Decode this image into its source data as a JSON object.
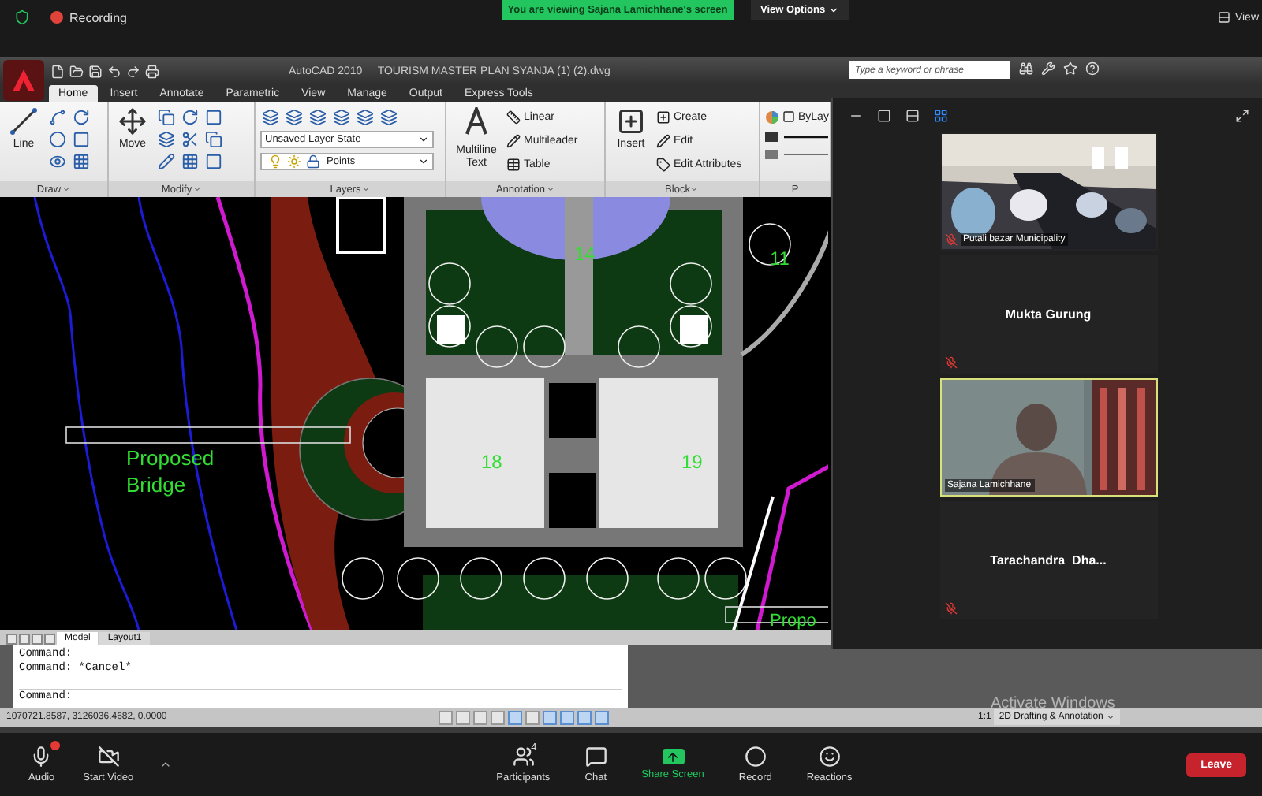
{
  "meeting_bar": {
    "recording_label": "Recording",
    "share_banner": "You are viewing Sajana Lamichhane's screen",
    "view_options": "View Options",
    "view_button": "View"
  },
  "cad": {
    "app_title": "AutoCAD 2010",
    "file_title": "TOURISM MASTER PLAN SYANJA (1) (2).dwg",
    "search": {
      "placeholder": "Type a keyword or phrase"
    },
    "ribbon_tabs": [
      {
        "label": "Home",
        "selected": true
      },
      {
        "label": "Insert",
        "selected": false
      },
      {
        "label": "Annotate",
        "selected": false
      },
      {
        "label": "Parametric",
        "selected": false
      },
      {
        "label": "View",
        "selected": false
      },
      {
        "label": "Manage",
        "selected": false
      },
      {
        "label": "Output",
        "selected": false
      },
      {
        "label": "Express Tools",
        "selected": false
      }
    ],
    "ribbon_panels": [
      {
        "kind": "draw",
        "title": "Draw",
        "big": "Line"
      },
      {
        "kind": "modify",
        "title": "Modify",
        "big": "Move"
      },
      {
        "kind": "layers",
        "title": "Layers",
        "layer_state": "Unsaved Layer State",
        "layer": "Points"
      },
      {
        "kind": "annotation",
        "title": "Annotation",
        "big": "Multiline Text",
        "items": [
          "Linear",
          "Multileader",
          "Table"
        ]
      },
      {
        "kind": "block",
        "title": "Block",
        "big": "Insert",
        "items": [
          "Create",
          "Edit",
          "Edit Attributes"
        ]
      },
      {
        "kind": "properties",
        "title": "P",
        "color_value": "ByLay"
      }
    ],
    "drawing_labels": [
      {
        "text": "Proposed",
        "kind": "bridge"
      },
      {
        "text": "Bridge",
        "kind": "bridge"
      },
      {
        "text": "14",
        "kind": "plot"
      },
      {
        "text": "11",
        "kind": "plot"
      },
      {
        "text": "18",
        "kind": "plot"
      },
      {
        "text": "19",
        "kind": "plot"
      },
      {
        "text": "Propo",
        "kind": "edge"
      }
    ],
    "layout_tabs": [
      {
        "label": "Model",
        "selected": true
      },
      {
        "label": "Layout1",
        "selected": false
      }
    ],
    "command_history": [
      "Command:",
      "Command: *Cancel*"
    ],
    "command_prompt": "Command:",
    "coordinates": "1070721.8587, 3126036.4682, 0.0000",
    "scale": "1:1",
    "workspace": "2D Drafting & Annotation"
  },
  "os_notice": "Activate Windows",
  "gallery": {
    "tiles": [
      {
        "name": "Putali bazar Municipality",
        "kind": "video",
        "muted": true,
        "speaking": false
      },
      {
        "name": "Mukta Gurung",
        "kind": "avatar",
        "muted": true,
        "speaking": false
      },
      {
        "name": "Sajana Lamichhane",
        "kind": "video",
        "muted": false,
        "speaking": true
      },
      {
        "name": "Tarachandra  Dha...",
        "kind": "avatar",
        "muted": true,
        "speaking": false
      }
    ]
  },
  "toolbar": {
    "items": [
      {
        "kind": "audio",
        "label": "Audio"
      },
      {
        "kind": "video",
        "label": "Start Video"
      },
      {
        "kind": "participants",
        "label": "Participants",
        "count": "4"
      },
      {
        "kind": "chat",
        "label": "Chat"
      },
      {
        "kind": "share",
        "label": "Share Screen"
      },
      {
        "kind": "record",
        "label": "Record"
      },
      {
        "kind": "reactions",
        "label": "Reactions"
      }
    ],
    "leave": "Leave"
  }
}
